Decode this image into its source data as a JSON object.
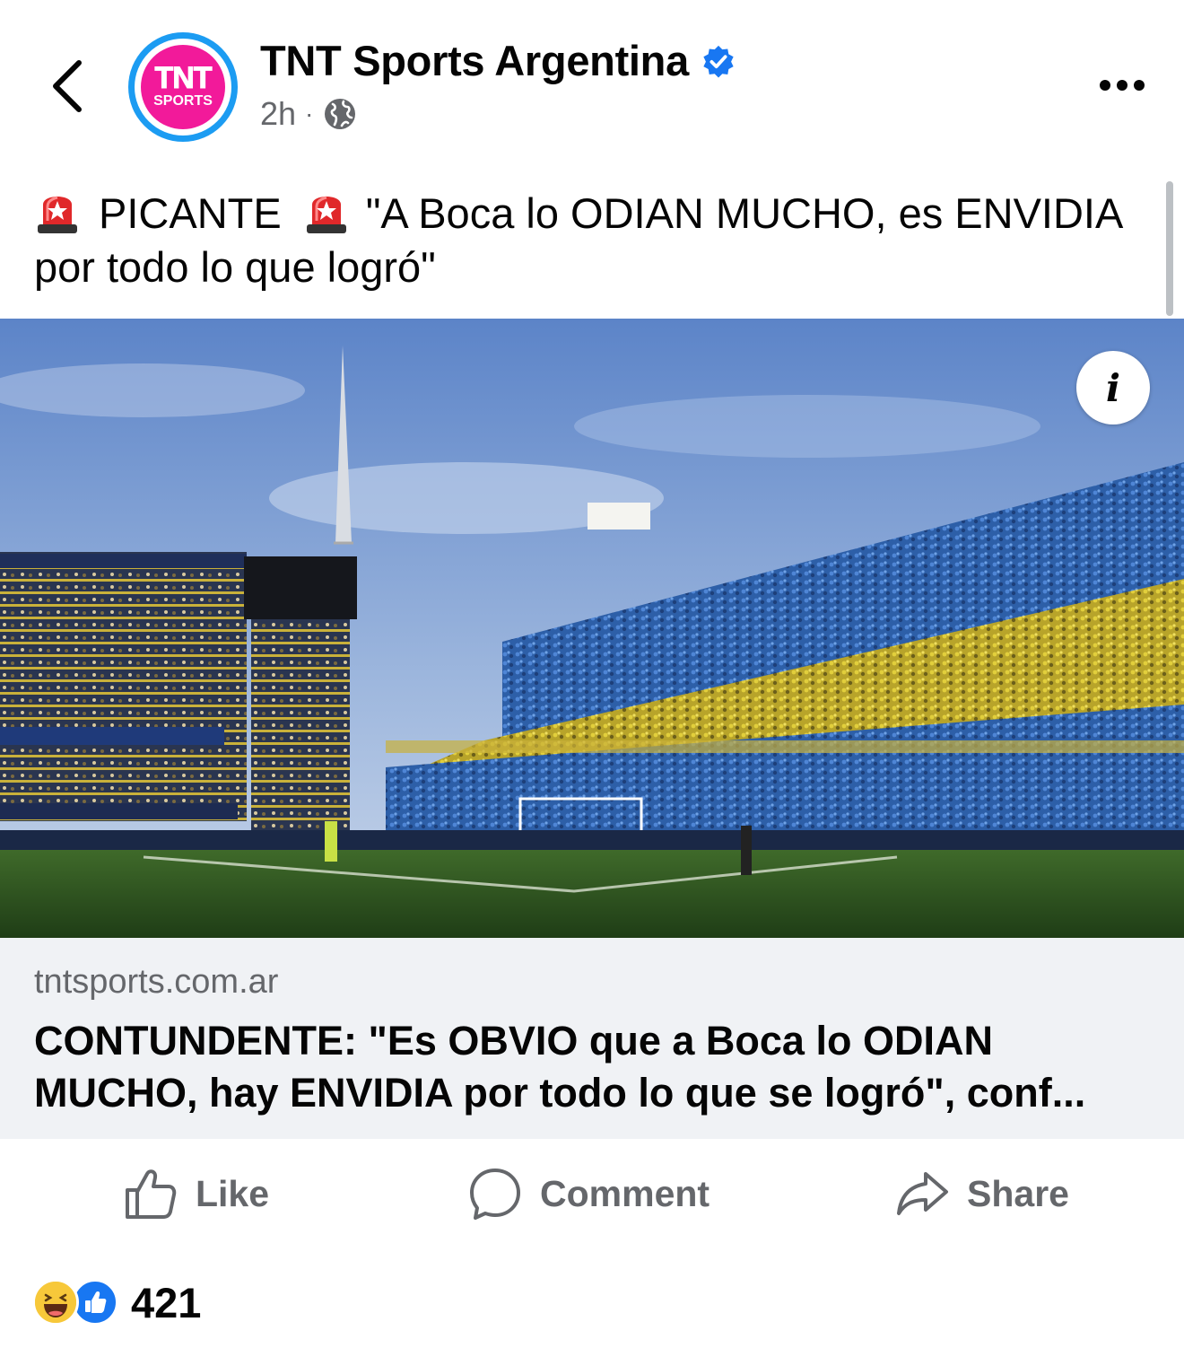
{
  "header": {
    "page_name": "TNT Sports Argentina",
    "time": "2h",
    "separator": "·",
    "avatar_line1": "TNT",
    "avatar_line2": "SPORTS"
  },
  "post": {
    "caption_word1": "PICANTE",
    "caption_rest": "\"A Boca lo ODIAN MUCHO, es ENVIDIA por todo lo que logró\""
  },
  "link_preview": {
    "domain": "tntsports.com.ar",
    "title": "CONTUNDENTE: \"Es OBVIO que a Boca lo ODIAN MUCHO, hay ENVIDIA por todo lo que se logró\", conf..."
  },
  "actions": {
    "like": "Like",
    "comment": "Comment",
    "share": "Share"
  },
  "reactions": {
    "count": "421"
  },
  "image": {
    "info_glyph": "i"
  },
  "colors": {
    "brand_blue": "#1877f2",
    "tnt_pink": "#f21a9a",
    "secondary_text": "#65676b",
    "link_card_bg": "#f0f2f5"
  }
}
